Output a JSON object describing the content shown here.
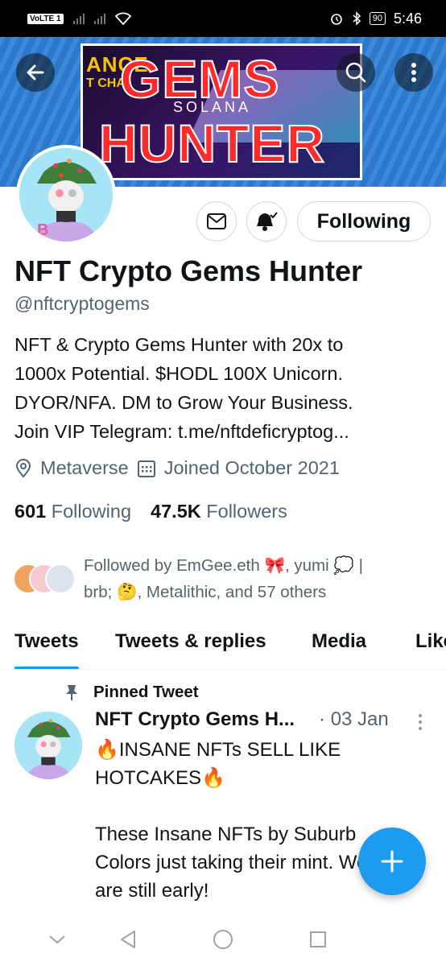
{
  "status_bar": {
    "volte": "VoLTE",
    "sim": "1",
    "battery": "90",
    "time": "5:46"
  },
  "banner": {
    "line1": "GEMS",
    "line2": "HUNTER",
    "bg_text1": "ANCE",
    "bg_text2": "T CHA",
    "bg_text3": "SOLANA"
  },
  "profile": {
    "follow_button": "Following",
    "name": "NFT Crypto Gems Hunter",
    "handle": "@nftcryptogems",
    "bio_lines": [
      "NFT & Crypto Gems Hunter with 20x to",
      "1000x Potential. $HODL 100X Unicorn.",
      "DYOR/NFA. DM to Grow Your Business.",
      "Join VIP Telegram: t.me/nftdeficryptog..."
    ],
    "location": "Metaverse",
    "joined": "Joined October 2021",
    "following_count": "601",
    "following_label": "Following",
    "followers_count": "47.5K",
    "followers_label": "Followers",
    "followed_by_line1": "Followed by EmGee.eth 🎀, yumi 💭 |",
    "followed_by_line2": "brb; 🤔, Metalithic, and 57 others"
  },
  "tabs": [
    "Tweets",
    "Tweets & replies",
    "Media",
    "Likes"
  ],
  "tweet": {
    "pinned_label": "Pinned Tweet",
    "author": "NFT Crypto Gems H...",
    "date": "· 03 Jan",
    "lines": [
      "🔥INSANE NFTs SELL LIKE",
      "HOTCAKES🔥",
      "",
      "These Insane NFTs by Suburb",
      "Colors just taking their mint. We",
      "are still early!"
    ]
  },
  "colors": {
    "accent": "#1d9bf0",
    "text": "#0f1419",
    "muted": "#536471",
    "banner_bg": "#2e7fd6"
  },
  "icons": [
    "back-arrow-icon",
    "search-icon",
    "more-vertical-icon",
    "mail-icon",
    "bell-check-icon",
    "location-pin-icon",
    "calendar-icon",
    "pin-icon",
    "plus-icon",
    "nav-back-icon",
    "nav-home-icon",
    "nav-recents-icon",
    "nav-collapse-icon"
  ]
}
